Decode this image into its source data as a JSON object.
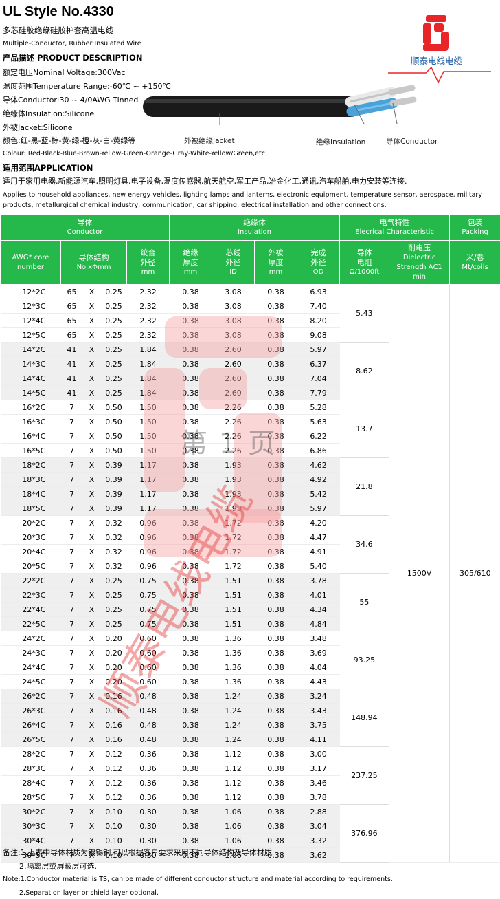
{
  "header": {
    "title": "UL Style No.4330",
    "subtitle_cn": "多芯硅胶绝缘硅胶护套高温电线",
    "subtitle_en": "Multiple-Conductor, Rubber Insulated Wire",
    "desc_heading": "产品描述 PRODUCT DESCRIPTION",
    "lines": [
      "额定电压Nominal Voltage:300Vac",
      "温度范围Temperature Range:-60℃ ~ +150℃",
      "导体Conductor:30 ~ 4/0AWG Tinned",
      "绝缘体Insulation:Silicone",
      "外被Jacket:Silicone",
      "颜色:红-黑-蓝-棕-黄-绿-橙-灰-白-黄绿等",
      "Colour: Red-Black-Blue-Brown-Yellow-Green-Orange-Gray-White-Yellow/Green,etc."
    ],
    "app_heading": "适用范围APPLICATION",
    "app_cn": "适用于家用电器,新能源汽车,照明灯具,电子设备,温度传感器,航天航空,军工产品,冶金化工,通讯,汽车船舶,电力安装等连接.",
    "app_en_1": "Applies to household appliances, new energy vehicles, lighting lamps and lanterns, electronic equipment, temperature sensor, aerospace, military",
    "app_en_2": "products, metallurgical chemical industry, communication, car shipping, electrical installation and other connections."
  },
  "logo": {
    "brand": "顺泰电线电缆",
    "color": "#e8262a",
    "text_color": "#1f5fa8"
  },
  "cable_labels": {
    "jacket": "外被绝缘Jacket",
    "insulation": "绝缘Insulation",
    "conductor": "导体Conductor"
  },
  "table": {
    "group_headers": [
      {
        "cn": "导体",
        "en": "Conductor"
      },
      {
        "cn": "绝缘体",
        "en": "Insulation"
      },
      {
        "cn": "电气特性",
        "en": "Elecrical Characteristic"
      },
      {
        "cn": "包装",
        "en": "Packing"
      }
    ],
    "col_headers": {
      "awg": "AWG* core number",
      "structure_1": "导体结构",
      "structure_2": "No.xΦmm",
      "od_cond_1": "绞合",
      "od_cond_2": "外径",
      "od_cond_3": "mm",
      "ins_thk_1": "绝缘",
      "ins_thk_2": "厚度",
      "ins_thk_3": "mm",
      "core_od_1": "芯线",
      "core_od_2": "外径",
      "core_od_3": "ID",
      "jkt_thk_1": "外被",
      "jkt_thk_2": "厚度",
      "jkt_thk_3": "mm",
      "fin_od_1": "完成",
      "fin_od_2": "外径",
      "fin_od_3": "OD",
      "res_1": "导体",
      "res_2": "电阻",
      "res_3": "Ω/1000ft",
      "dv_1": "耐电压",
      "dv_2": "Dielectric",
      "dv_3": "Strength AC1",
      "dv_4": "min",
      "pk_1": "米/卷",
      "pk_2": "Mt/coils"
    },
    "dielectric": "1500V",
    "packing": "305/610",
    "groups": [
      {
        "resistance": "5.43",
        "rows": [
          [
            "12*2C",
            "65",
            "X",
            "0.25",
            "2.32",
            "0.38",
            "3.08",
            "0.38",
            "6.93"
          ],
          [
            "12*3C",
            "65",
            "X",
            "0.25",
            "2.32",
            "0.38",
            "3.08",
            "0.38",
            "7.40"
          ],
          [
            "12*4C",
            "65",
            "X",
            "0.25",
            "2.32",
            "0.38",
            "3.08",
            "0.38",
            "8.20"
          ],
          [
            "12*5C",
            "65",
            "X",
            "0.25",
            "2.32",
            "0.38",
            "3.08",
            "0.38",
            "9.08"
          ]
        ]
      },
      {
        "resistance": "8.62",
        "rows": [
          [
            "14*2C",
            "41",
            "X",
            "0.25",
            "1.84",
            "0.38",
            "2.60",
            "0.38",
            "5.97"
          ],
          [
            "14*3C",
            "41",
            "X",
            "0.25",
            "1.84",
            "0.38",
            "2.60",
            "0.38",
            "6.37"
          ],
          [
            "14*4C",
            "41",
            "X",
            "0.25",
            "1.84",
            "0.38",
            "2.60",
            "0.38",
            "7.04"
          ],
          [
            "14*5C",
            "41",
            "X",
            "0.25",
            "1.84",
            "0.38",
            "2.60",
            "0.38",
            "7.79"
          ]
        ]
      },
      {
        "resistance": "13.7",
        "rows": [
          [
            "16*2C",
            "7",
            "X",
            "0.50",
            "1.50",
            "0.38",
            "2.26",
            "0.38",
            "5.28"
          ],
          [
            "16*3C",
            "7",
            "X",
            "0.50",
            "1.50",
            "0.38",
            "2.26",
            "0.38",
            "5.63"
          ],
          [
            "16*4C",
            "7",
            "X",
            "0.50",
            "1.50",
            "0.38",
            "2.26",
            "0.38",
            "6.22"
          ],
          [
            "16*5C",
            "7",
            "X",
            "0.50",
            "1.50",
            "0.38",
            "2.26",
            "0.38",
            "6.86"
          ]
        ]
      },
      {
        "resistance": "21.8",
        "rows": [
          [
            "18*2C",
            "7",
            "X",
            "0.39",
            "1.17",
            "0.38",
            "1.93",
            "0.38",
            "4.62"
          ],
          [
            "18*3C",
            "7",
            "X",
            "0.39",
            "1.17",
            "0.38",
            "1.93",
            "0.38",
            "4.92"
          ],
          [
            "18*4C",
            "7",
            "X",
            "0.39",
            "1.17",
            "0.38",
            "1.93",
            "0.38",
            "5.42"
          ],
          [
            "18*5C",
            "7",
            "X",
            "0.39",
            "1.17",
            "0.38",
            "1.93",
            "0.38",
            "5.97"
          ]
        ]
      },
      {
        "resistance": "34.6",
        "rows": [
          [
            "20*2C",
            "7",
            "X",
            "0.32",
            "0.96",
            "0.38",
            "1.72",
            "0.38",
            "4.20"
          ],
          [
            "20*3C",
            "7",
            "X",
            "0.32",
            "0.96",
            "0.38",
            "1.72",
            "0.38",
            "4.47"
          ],
          [
            "20*4C",
            "7",
            "X",
            "0.32",
            "0.96",
            "0.38",
            "1.72",
            "0.38",
            "4.91"
          ],
          [
            "20*5C",
            "7",
            "X",
            "0.32",
            "0.96",
            "0.38",
            "1.72",
            "0.38",
            "5.40"
          ]
        ]
      },
      {
        "resistance": "55",
        "rows": [
          [
            "22*2C",
            "7",
            "X",
            "0.25",
            "0.75",
            "0.38",
            "1.51",
            "0.38",
            "3.78"
          ],
          [
            "22*3C",
            "7",
            "X",
            "0.25",
            "0.75",
            "0.38",
            "1.51",
            "0.38",
            "4.01"
          ],
          [
            "22*4C",
            "7",
            "X",
            "0.25",
            "0.75",
            "0.38",
            "1.51",
            "0.38",
            "4.34"
          ],
          [
            "22*5C",
            "7",
            "X",
            "0.25",
            "0.75",
            "0.38",
            "1.51",
            "0.38",
            "4.84"
          ]
        ]
      },
      {
        "resistance": "93.25",
        "rows": [
          [
            "24*2C",
            "7",
            "X",
            "0.20",
            "0.60",
            "0.38",
            "1.36",
            "0.38",
            "3.48"
          ],
          [
            "24*3C",
            "7",
            "X",
            "0.20",
            "0.60",
            "0.38",
            "1.36",
            "0.38",
            "3.69"
          ],
          [
            "24*4C",
            "7",
            "X",
            "0.20",
            "0.60",
            "0.38",
            "1.36",
            "0.38",
            "4.04"
          ],
          [
            "24*5C",
            "7",
            "X",
            "0.20",
            "0.60",
            "0.38",
            "1.36",
            "0.38",
            "4.43"
          ]
        ]
      },
      {
        "resistance": "148.94",
        "rows": [
          [
            "26*2C",
            "7",
            "X",
            "0.16",
            "0.48",
            "0.38",
            "1.24",
            "0.38",
            "3.24"
          ],
          [
            "26*3C",
            "7",
            "X",
            "0.16",
            "0.48",
            "0.38",
            "1.24",
            "0.38",
            "3.43"
          ],
          [
            "26*4C",
            "7",
            "X",
            "0.16",
            "0.48",
            "0.38",
            "1.24",
            "0.38",
            "3.75"
          ],
          [
            "26*5C",
            "7",
            "X",
            "0.16",
            "0.48",
            "0.38",
            "1.24",
            "0.38",
            "4.11"
          ]
        ]
      },
      {
        "resistance": "237.25",
        "rows": [
          [
            "28*2C",
            "7",
            "X",
            "0.12",
            "0.36",
            "0.38",
            "1.12",
            "0.38",
            "3.00"
          ],
          [
            "28*3C",
            "7",
            "X",
            "0.12",
            "0.36",
            "0.38",
            "1.12",
            "0.38",
            "3.17"
          ],
          [
            "28*4C",
            "7",
            "X",
            "0.12",
            "0.36",
            "0.38",
            "1.12",
            "0.38",
            "3.46"
          ],
          [
            "28*5C",
            "7",
            "X",
            "0.12",
            "0.36",
            "0.38",
            "1.12",
            "0.38",
            "3.78"
          ]
        ]
      },
      {
        "resistance": "376.96",
        "rows": [
          [
            "30*2C",
            "7",
            "X",
            "0.10",
            "0.30",
            "0.38",
            "1.06",
            "0.38",
            "2.88"
          ],
          [
            "30*3C",
            "7",
            "X",
            "0.10",
            "0.30",
            "0.38",
            "1.06",
            "0.38",
            "3.04"
          ],
          [
            "30*4C",
            "7",
            "X",
            "0.10",
            "0.30",
            "0.38",
            "1.06",
            "0.38",
            "3.32"
          ],
          [
            "30*5C",
            "7",
            "X",
            "0.10",
            "0.30",
            "0.38",
            "1.06",
            "0.38",
            "3.62"
          ]
        ]
      }
    ]
  },
  "watermark": {
    "page": "第 1 页",
    "brand": "顺泰电线电缆"
  },
  "footer": {
    "note_cn_1": "备注:1.上表中导体材质为镀锡铜,可以根据客户要求采用不同导体结构及导体材质.",
    "note_cn_2": "2.隔离层或屏蔽层可选.",
    "note_en_1": "Note:1.Conductor material is TS, can be made of different conductor structure and material according to requirements.",
    "note_en_2": "2.Separation layer or shield layer optional."
  }
}
